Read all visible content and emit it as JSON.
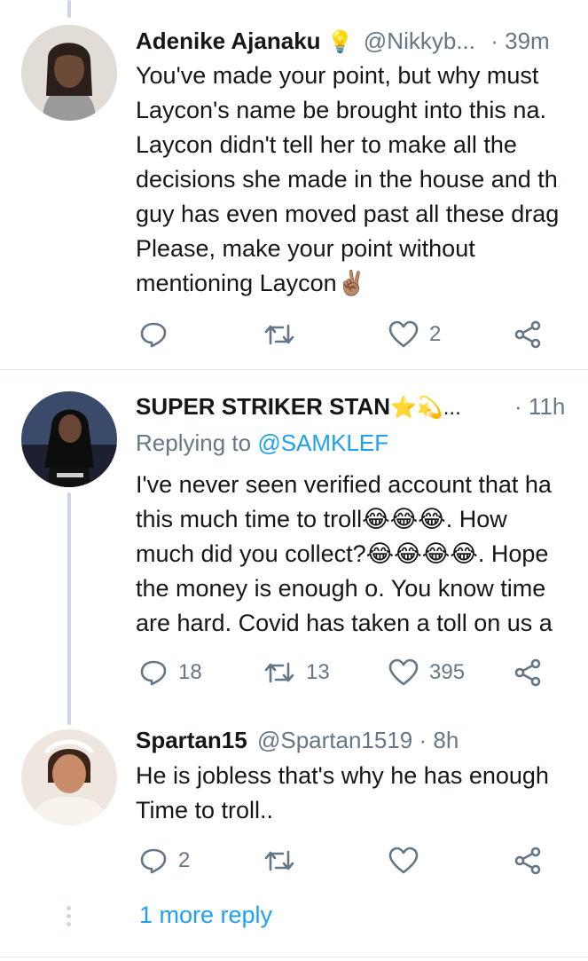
{
  "tweets": [
    {
      "name": "Adenike Ajanaku",
      "name_emoji": "💡",
      "handle": "@Nikkyb...",
      "time": "39m",
      "lines": [
        "You've made your point, but why must",
        "Laycon's name be brought into this na.",
        "Laycon didn't tell her to make all the",
        "decisions she made in the house and th",
        "guy has even moved past all these drag",
        "Please, make your point without",
        "mentioning Laycon✌🏽"
      ],
      "replies": "",
      "retweets": "",
      "likes": "2"
    },
    {
      "name": "SUPER STRIKER STAN",
      "name_emoji": "⭐💫...",
      "handle": "",
      "time": "11h",
      "replying_prefix": "Replying to",
      "replying_to": "@SAMKLEF",
      "lines": [
        "I've never seen verified account that ha",
        "this much time to troll😂😂😂. How",
        "much did you collect?😂😂😂😂. Hope",
        "the money is enough o. You know time",
        "are hard. Covid has taken a toll on us a"
      ],
      "replies": "18",
      "retweets": "13",
      "likes": "395"
    },
    {
      "name": "Spartan15",
      "name_emoji": "",
      "handle": "@Spartan1519",
      "time": "8h",
      "lines": [
        "He is jobless that's why he has enough",
        "Time to troll.."
      ],
      "replies": "2",
      "retweets": "",
      "likes": ""
    }
  ],
  "more_reply": "1 more reply",
  "icons": [
    "reply-icon",
    "retweet-icon",
    "like-icon",
    "share-icon"
  ],
  "colors": {
    "link": "#1da1f2",
    "muted": "#657786",
    "line": "#ccd6dd"
  }
}
